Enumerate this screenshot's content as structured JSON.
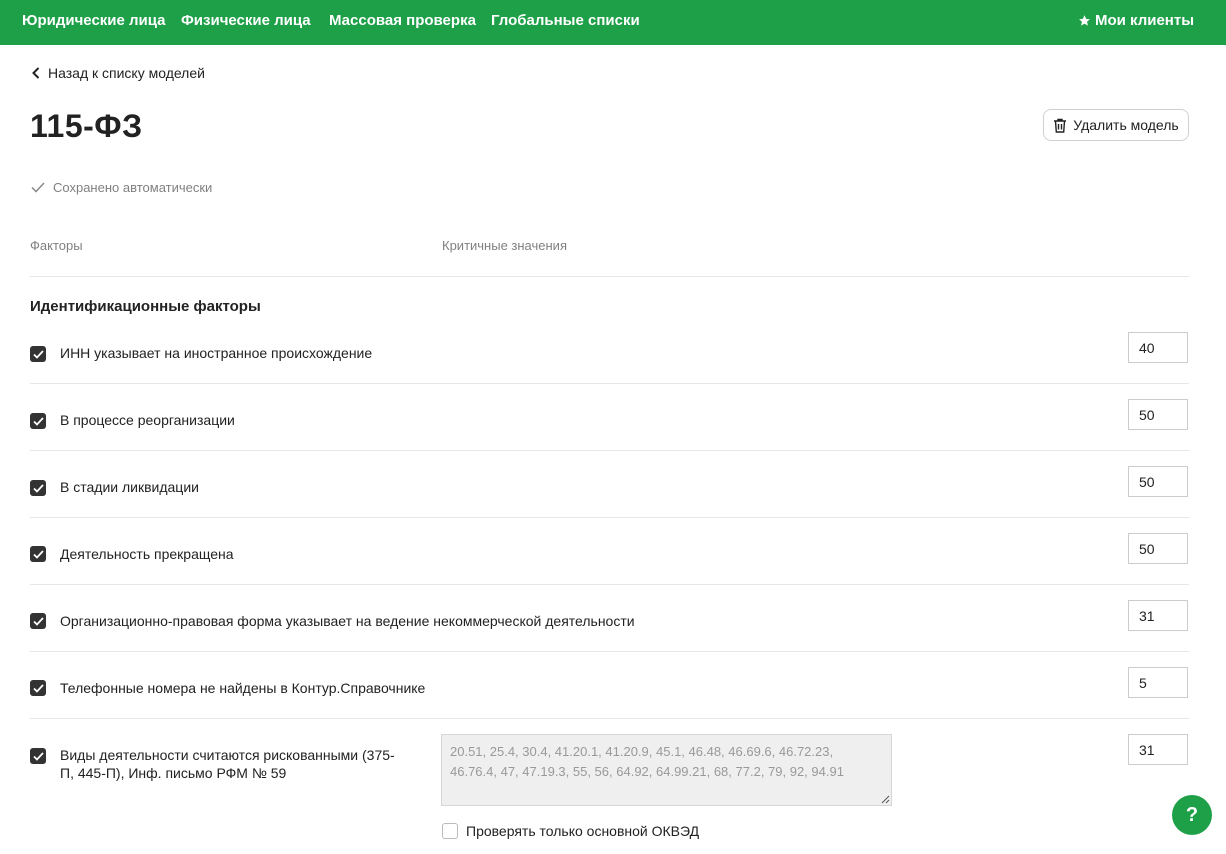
{
  "nav": {
    "items": [
      {
        "label": "Юридические лица"
      },
      {
        "label": "Физические лица"
      },
      {
        "label": "Массовая проверка"
      },
      {
        "label": "Глобальные списки"
      }
    ],
    "my_clients": "Мои клиенты"
  },
  "back_link": "Назад к списку моделей",
  "title": "115-ФЗ",
  "delete_button": "Удалить модель",
  "saved_status": "Сохранено автоматически",
  "columns": {
    "factors": "Факторы",
    "critical_values": "Критичные значения"
  },
  "section_title": "Идентификационные факторы",
  "factors": [
    {
      "label": "ИНН указывает на иностранное происхождение",
      "value": "40",
      "checked": true
    },
    {
      "label": "В процессе реорганизации",
      "value": "50",
      "checked": true
    },
    {
      "label": "В стадии ликвидации",
      "value": "50",
      "checked": true
    },
    {
      "label": "Деятельность прекращена",
      "value": "50",
      "checked": true
    },
    {
      "label": "Организационно-правовая форма указывает на ведение некоммерческой деятельности",
      "value": "31",
      "checked": true
    },
    {
      "label": "Телефонные номера не найдены в Контур.Справочнике",
      "value": "5",
      "checked": true
    },
    {
      "label": "Виды деятельности считаются рискованными (375-П, 445-П), Инф. письмо РФМ № 59",
      "value": "31",
      "checked": true
    }
  ],
  "okved_codes": "20.51, 25.4, 30.4, 41.20.1, 41.20.9, 45.1, 46.48, 46.69.6, 46.72.23, 46.76.4, 47, 47.19.3, 55, 56, 64.92, 64.99.21, 68, 77.2, 79, 92, 94.91",
  "okved_main_only": "Проверять только основной ОКВЭД",
  "help": "?"
}
